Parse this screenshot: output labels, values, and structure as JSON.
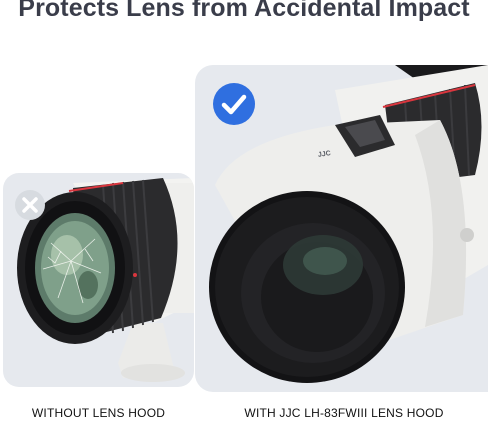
{
  "headline": "Protects Lens from Accidental Impact",
  "left_panel": {
    "caption": "WITHOUT LENS HOOD",
    "badge_icon": "x-mark-icon",
    "badge_color": "#d7dbe0"
  },
  "right_panel": {
    "caption": "WITH JJC LH-83FWIII LENS HOOD",
    "badge_icon": "checkmark-icon",
    "badge_color": "#2f6fe0",
    "hood_brand": "JJC"
  },
  "colors": {
    "panel_background": "#e6e9ee",
    "lens_body": "#f2f2f0",
    "lens_ring": "#2a2a2c",
    "accent_red": "#d9363e"
  }
}
